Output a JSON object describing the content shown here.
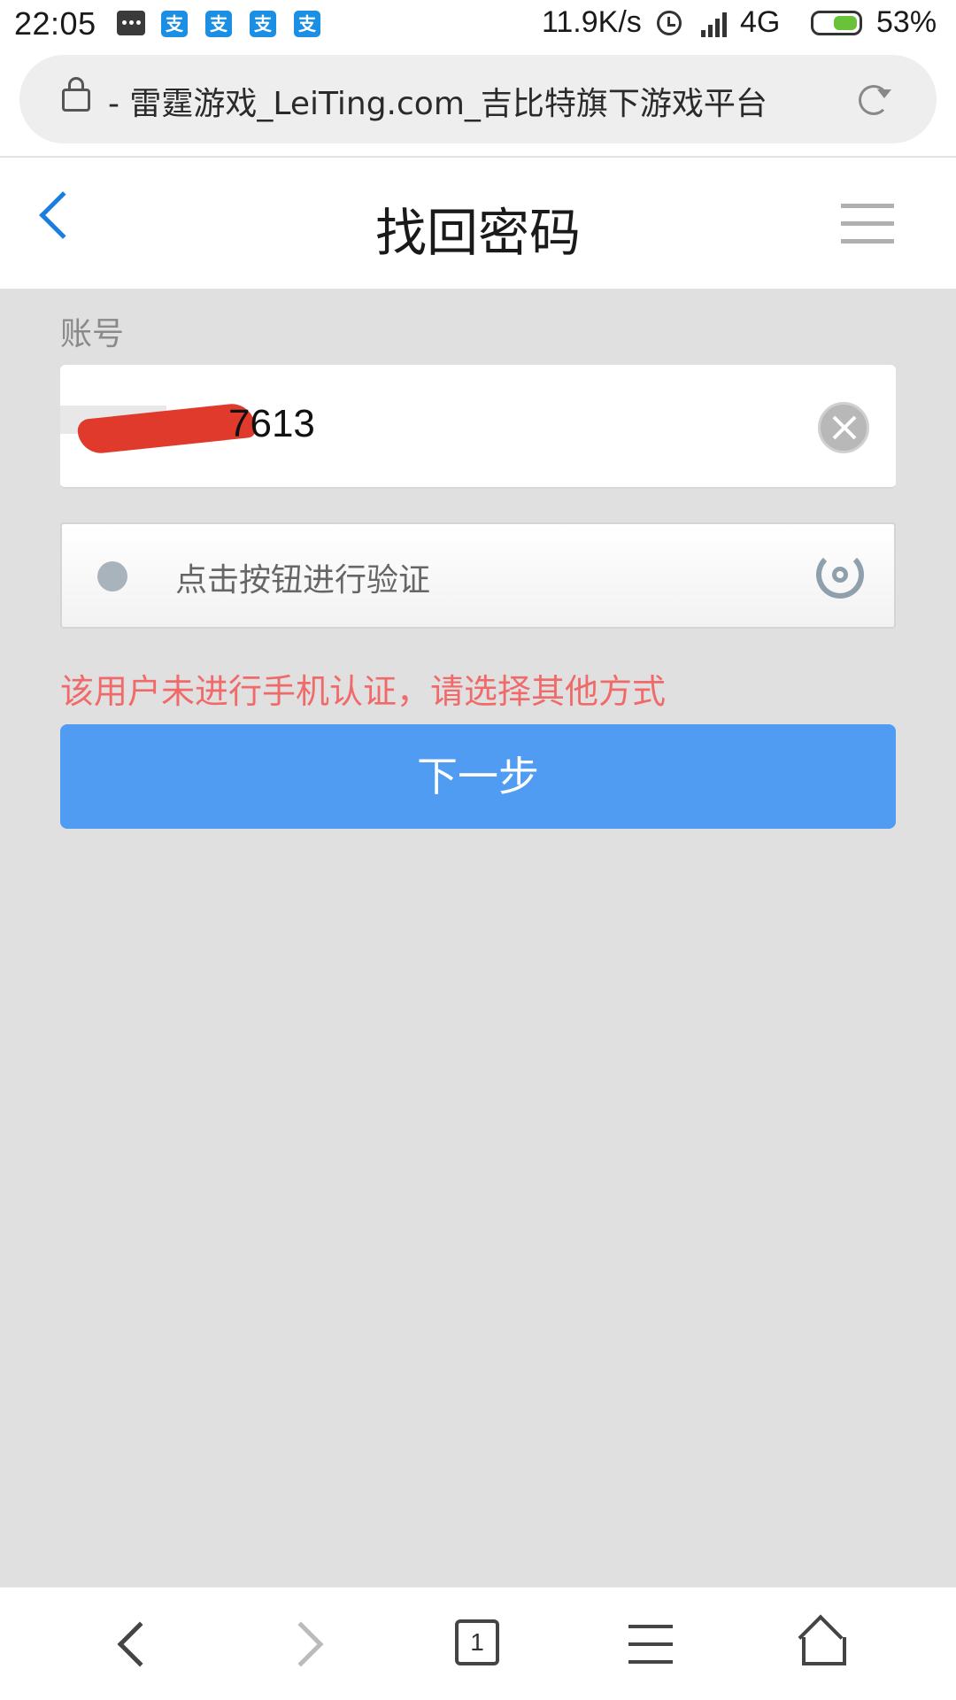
{
  "status_bar": {
    "time": "22:05",
    "net_speed": "11.9K/s",
    "network": "4G",
    "battery": "53%",
    "icons": [
      "message-icon",
      "alipay-icon",
      "alipay-icon",
      "alipay-icon",
      "alipay-icon",
      "alarm-icon",
      "signal-icon",
      "battery-icon"
    ]
  },
  "browser": {
    "url_text": "- 雷霆游戏_LeiTing.com_吉比特旗下游戏平台"
  },
  "header": {
    "title": "找回密码"
  },
  "form": {
    "account_label": "账号",
    "account_value": "7613",
    "verify_text": "点击按钮进行验证",
    "error_text": "该用户未进行手机认证，请选择其他方式",
    "next_button": "下一步"
  },
  "bottom_nav": {
    "tab_count": "1"
  },
  "colors": {
    "accent_blue": "#4f9cf2",
    "back_blue": "#1a7de0",
    "error_red": "#f06a6a",
    "page_bg": "#e0e0e0"
  }
}
